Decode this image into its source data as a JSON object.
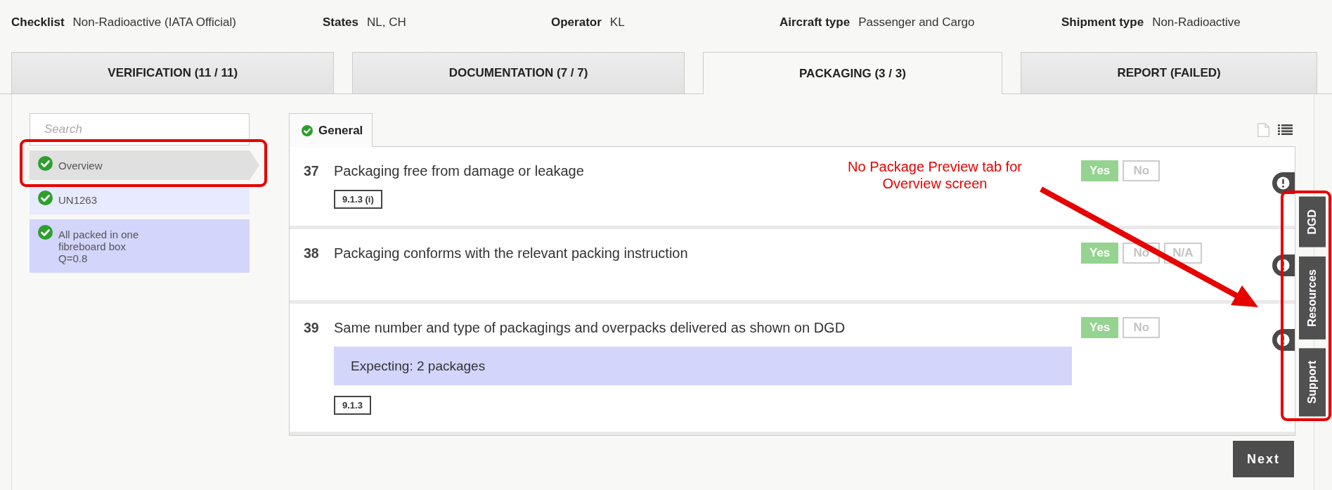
{
  "header": {
    "fields": [
      {
        "label": "Checklist",
        "value": "Non-Radioactive (IATA Official)"
      },
      {
        "label": "States",
        "value": "NL, CH"
      },
      {
        "label": "Operator",
        "value": "KL"
      },
      {
        "label": "Aircraft type",
        "value": "Passenger and Cargo"
      },
      {
        "label": "Shipment type",
        "value": "Non-Radioactive"
      }
    ]
  },
  "tabs": [
    {
      "label": "VERIFICATION (11 / 11)",
      "selected": false
    },
    {
      "label": "DOCUMENTATION (7 / 7)",
      "selected": false
    },
    {
      "label": "PACKAGING (3 / 3)",
      "selected": true
    },
    {
      "label": "REPORT (FAILED)",
      "selected": false
    }
  ],
  "sidebar": {
    "search": {
      "placeholder": "Search"
    },
    "items": [
      {
        "label": "Overview",
        "kind": "overview",
        "complete": true,
        "selected": true
      },
      {
        "label": "UN1263",
        "kind": "substance",
        "complete": true,
        "selected": false
      },
      {
        "label": "All packed in one\nfibreboard box\nQ=0.8",
        "kind": "package",
        "complete": true,
        "selected": false
      }
    ]
  },
  "section_tabs": [
    {
      "label": "General",
      "complete": true,
      "selected": true
    }
  ],
  "questions": [
    {
      "number": "37",
      "text": "Packaging free from damage or leakage",
      "references": [
        "9.1.3 (i)"
      ],
      "answers": [
        {
          "label": "Yes",
          "selected": true
        },
        {
          "label": "No",
          "selected": false
        }
      ]
    },
    {
      "number": "38",
      "text": "Packaging conforms with the relevant packing instruction",
      "answers": [
        {
          "label": "Yes",
          "selected": true
        },
        {
          "label": "No",
          "selected": false
        },
        {
          "label": "N/A",
          "selected": false
        }
      ]
    },
    {
      "number": "39",
      "text": "Same number and type of packagings and overpacks delivered as shown on DGD",
      "expectation": "Expecting: 2 packages",
      "references": [
        "9.1.3"
      ],
      "answers": [
        {
          "label": "Yes",
          "selected": true
        },
        {
          "label": "No",
          "selected": false
        }
      ]
    }
  ],
  "side_tabs": [
    "DGD",
    "Resources",
    "Support"
  ],
  "next_button": "Next",
  "annotation": {
    "note": "No Package Preview tab for Overview screen"
  }
}
